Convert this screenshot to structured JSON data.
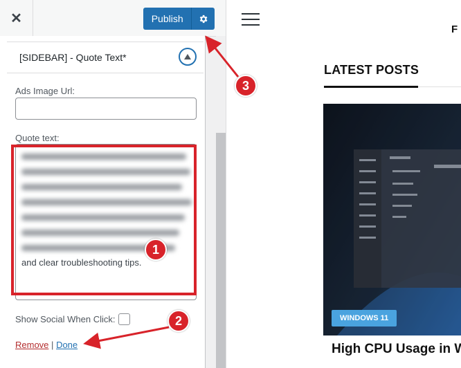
{
  "toolbar": {
    "close_icon": "close-icon",
    "publish_label": "Publish",
    "settings_icon": "gear-icon"
  },
  "widget": {
    "title": "[SIDEBAR] - Quote Text*",
    "ads_label": "Ads Image Url:",
    "ads_value": "",
    "quote_label": "Quote text:",
    "quote_last_line": "and clear troubleshooting tips.",
    "social_label": "Show Social When Click:",
    "social_checked": false,
    "remove_label": "Remove",
    "separator": "|",
    "done_label": "Done"
  },
  "preview": {
    "logo_fragment": "F",
    "section_title": "LATEST POSTS",
    "post_badge": "WINDOWS 11",
    "post_title": "High CPU Usage in W"
  },
  "annotations": [
    "1",
    "2",
    "3"
  ],
  "colors": {
    "accent": "#2271b1",
    "annotation": "#d8232a",
    "badge": "#4aa3df"
  }
}
